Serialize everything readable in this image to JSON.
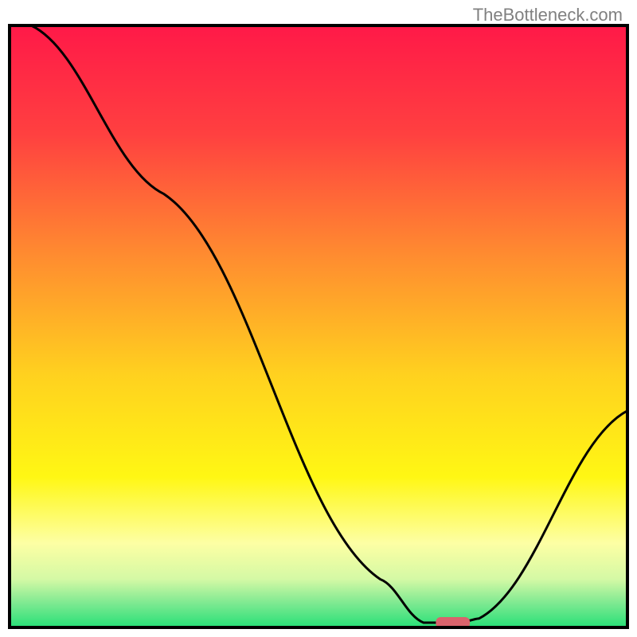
{
  "watermark": "TheBottleneck.com",
  "chart_data": {
    "type": "line",
    "title": "",
    "xlabel": "",
    "ylabel": "",
    "x_range": [
      0,
      100
    ],
    "y_range": [
      0,
      100
    ],
    "curve": [
      {
        "x": 3.5,
        "y": 100
      },
      {
        "x": 25,
        "y": 72
      },
      {
        "x": 60,
        "y": 8
      },
      {
        "x": 67,
        "y": 0.8
      },
      {
        "x": 73,
        "y": 0.8
      },
      {
        "x": 76,
        "y": 1.5
      },
      {
        "x": 100,
        "y": 36
      }
    ],
    "marker": {
      "x_start": 69,
      "x_end": 74.5,
      "y": 0.8,
      "color": "#d9636c"
    },
    "gradient_stops": [
      {
        "offset": 0,
        "color": "#ff1948"
      },
      {
        "offset": 18,
        "color": "#ff4040"
      },
      {
        "offset": 38,
        "color": "#ff8b30"
      },
      {
        "offset": 58,
        "color": "#ffd11f"
      },
      {
        "offset": 75,
        "color": "#fff714"
      },
      {
        "offset": 86,
        "color": "#fdffa4"
      },
      {
        "offset": 92,
        "color": "#d4f9a5"
      },
      {
        "offset": 96,
        "color": "#7de991"
      },
      {
        "offset": 100,
        "color": "#27e077"
      }
    ]
  }
}
